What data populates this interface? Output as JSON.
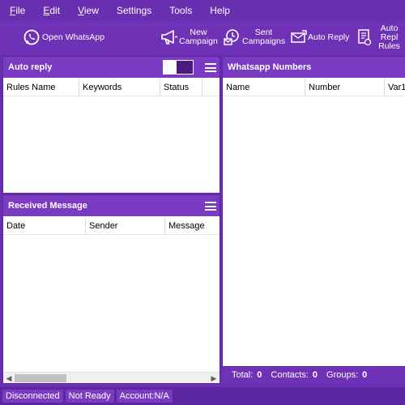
{
  "menu": [
    "File",
    "Edit",
    "View",
    "Settings",
    "Tools",
    "Help"
  ],
  "menu_underline": [
    "F",
    "E",
    "V",
    "",
    "",
    ""
  ],
  "toolbar": {
    "open_whatsapp": "Open WhatsApp",
    "new_campaign": [
      "New",
      "Campaign"
    ],
    "sent_campaigns": [
      "Sent",
      "Campaigns"
    ],
    "auto_reply": "Auto Reply",
    "auto_reply_rules": [
      "Auto Repl",
      "Rules"
    ]
  },
  "auto_reply_panel": {
    "title": "Auto reply",
    "columns": [
      "Rules Name",
      "Keywords",
      "Status"
    ]
  },
  "received_panel": {
    "title": "Received Message",
    "columns": [
      "Date",
      "Sender",
      "Message"
    ]
  },
  "numbers_panel": {
    "title": "Whatsapp Numbers",
    "columns": [
      "Name",
      "Number",
      "Var1"
    ]
  },
  "totals": {
    "total_label": "Total:",
    "total_value": "0",
    "contacts_label": "Contacts:",
    "contacts_value": "0",
    "groups_label": "Groups:",
    "groups_value": "0"
  },
  "status": [
    "Disconnected",
    "Not Ready",
    "Account:N/A"
  ],
  "colors": {
    "accent": "#6f32b6",
    "panel_header": "#7a3ac2",
    "background": "#6b2fb3"
  }
}
